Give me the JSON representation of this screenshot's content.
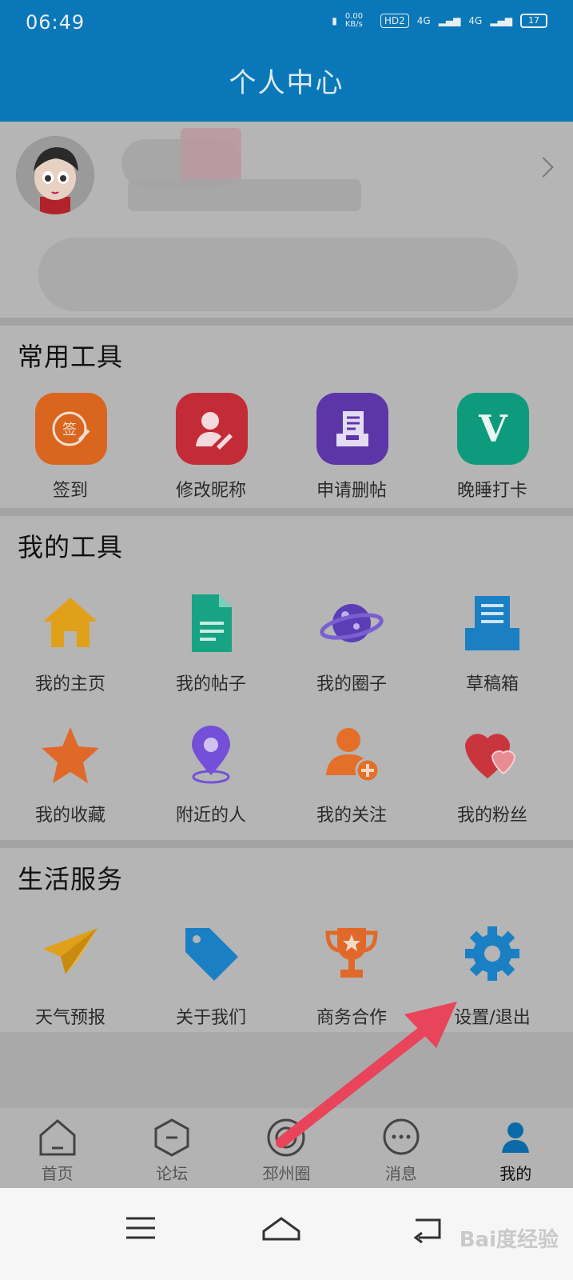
{
  "status_bar": {
    "time": "06:49",
    "net_speed": "0.00 KB/s",
    "hd_badge": "HD2",
    "signal1": "4G",
    "signal2": "4G",
    "battery": "17"
  },
  "header": {
    "title": "个人中心"
  },
  "sections": {
    "common": {
      "title": "常用工具",
      "items": [
        {
          "label": "签到",
          "icon": "sign-in-icon",
          "color": "#d9651e"
        },
        {
          "label": "修改昵称",
          "icon": "edit-nickname-icon",
          "color": "#c32b37"
        },
        {
          "label": "申请删帖",
          "icon": "delete-post-icon",
          "color": "#5c36a9"
        },
        {
          "label": "晚睡打卡",
          "icon": "v-icon",
          "color": "#0e9a7d"
        }
      ]
    },
    "mine": {
      "title": "我的工具",
      "items": [
        {
          "label": "我的主页",
          "icon": "home-icon",
          "color": "#e0a019"
        },
        {
          "label": "我的帖子",
          "icon": "document-icon",
          "color": "#18a384"
        },
        {
          "label": "我的圈子",
          "icon": "planet-icon",
          "color": "#5b3db5"
        },
        {
          "label": "草稿箱",
          "icon": "drafts-icon",
          "color": "#1b7fc4"
        },
        {
          "label": "我的收藏",
          "icon": "star-icon",
          "color": "#e0692a"
        },
        {
          "label": "附近的人",
          "icon": "location-icon",
          "color": "#7450d8"
        },
        {
          "label": "我的关注",
          "icon": "follow-icon",
          "color": "#e46f28"
        },
        {
          "label": "我的粉丝",
          "icon": "heart-icon",
          "color": "#c8353d"
        }
      ]
    },
    "life": {
      "title": "生活服务",
      "items": [
        {
          "label": "天气预报",
          "icon": "paper-plane-icon",
          "color": "#e0a019"
        },
        {
          "label": "关于我们",
          "icon": "tag-icon",
          "color": "#1b7fc4"
        },
        {
          "label": "商务合作",
          "icon": "trophy-icon",
          "color": "#e0692a"
        },
        {
          "label": "设置/退出",
          "icon": "gear-icon",
          "color": "#1b7fc4"
        }
      ]
    }
  },
  "tabbar": {
    "items": [
      {
        "label": "首页",
        "icon": "home-tab-icon"
      },
      {
        "label": "论坛",
        "icon": "forum-tab-icon"
      },
      {
        "label": "邳州圈",
        "icon": "circle-tab-icon"
      },
      {
        "label": "消息",
        "icon": "message-tab-icon"
      },
      {
        "label": "我的",
        "icon": "profile-tab-icon",
        "active": true
      }
    ]
  },
  "colors": {
    "accent": "#0a78b8",
    "annotation_arrow": "#e8445a"
  },
  "watermark": "Bai度经验"
}
